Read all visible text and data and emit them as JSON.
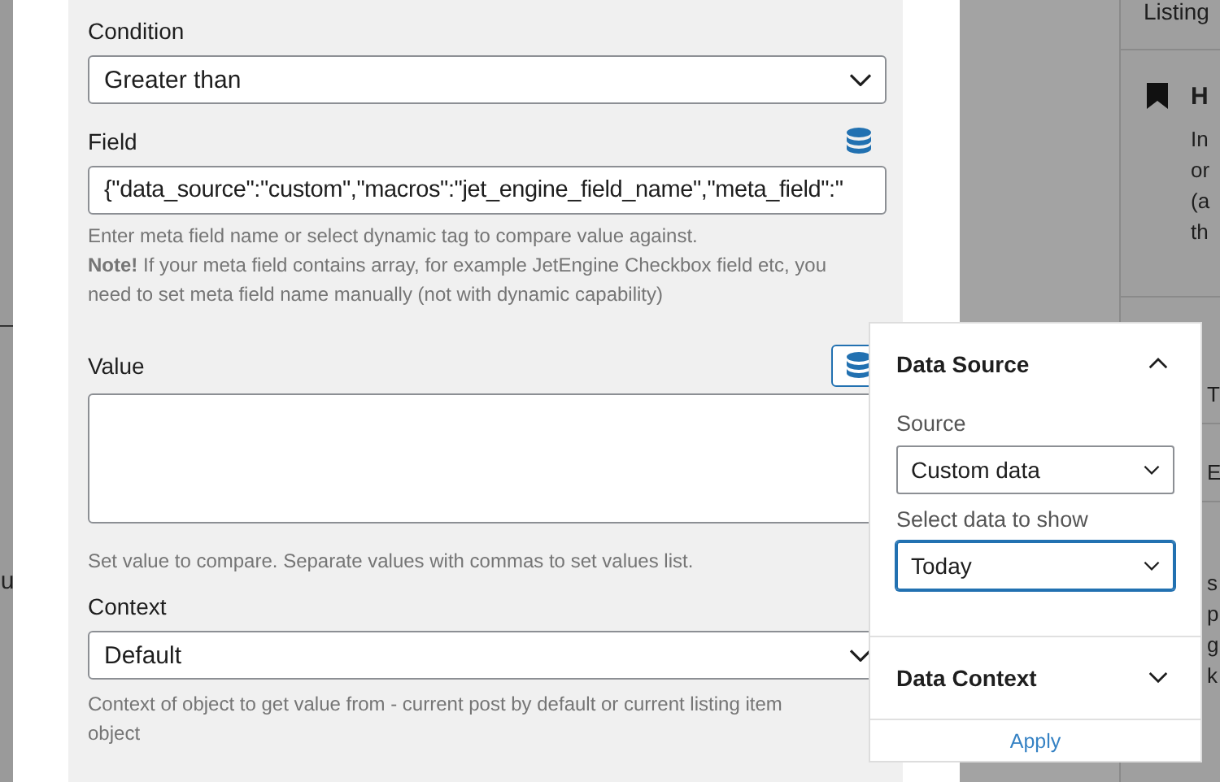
{
  "background": {
    "left_edge_text": "u"
  },
  "settings": {
    "condition": {
      "label": "Condition",
      "value": "Greater than"
    },
    "field": {
      "label": "Field",
      "value": "{\"data_source\":\"custom\",\"macros\":\"jet_engine_field_name\",\"meta_field\":\"",
      "help": "Enter meta field name or select dynamic tag to compare value against.",
      "note_label": "Note!",
      "note": "If your meta field contains array, for example JetEngine Checkbox field etc, you need to set meta field name manually (not with dynamic capability)"
    },
    "value": {
      "label": "Value",
      "help": "Set value to compare. Separate values with commas to set values list.",
      "dynamic_active": true
    },
    "context": {
      "label": "Context",
      "value": "Default",
      "help": "Context of object to get value from - current post by default or current listing item object"
    }
  },
  "sidebar": {
    "title": "Listing",
    "notice_title": "H",
    "notice_lines": [
      "In",
      "or",
      "(a",
      "th"
    ],
    "rows": [
      "T",
      "E"
    ],
    "lower_lines": [
      "s",
      "p",
      "g",
      "k"
    ]
  },
  "popover": {
    "sections": [
      {
        "title": "Data Source",
        "expanded": true,
        "fields": [
          {
            "label": "Source",
            "value": "Custom data",
            "focused": false
          },
          {
            "label": "Select data to show",
            "value": "Today",
            "focused": true
          }
        ]
      },
      {
        "title": "Data Context",
        "expanded": false
      }
    ],
    "apply": "Apply"
  }
}
